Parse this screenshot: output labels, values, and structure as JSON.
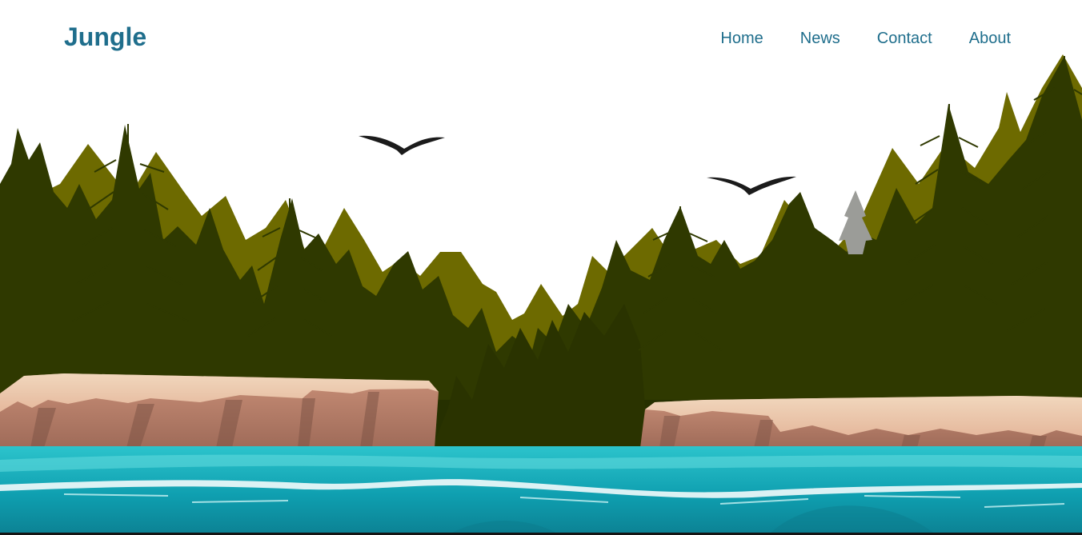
{
  "header": {
    "logo": "Jungle",
    "nav": [
      {
        "label": "Home"
      },
      {
        "label": "News"
      },
      {
        "label": "Contact"
      },
      {
        "label": "About"
      }
    ]
  },
  "hero": {
    "illustration": "forest-river-scene",
    "elements": [
      "pine-forest",
      "cliffs",
      "river",
      "birds"
    ],
    "colors": {
      "brand": "#1f6e8c",
      "tree_light": "#6d6a00",
      "tree_dark": "#2f3900",
      "cliff_top": "#e8c7a9",
      "cliff_face": "#b27a67",
      "water": "#17a4b1"
    }
  }
}
